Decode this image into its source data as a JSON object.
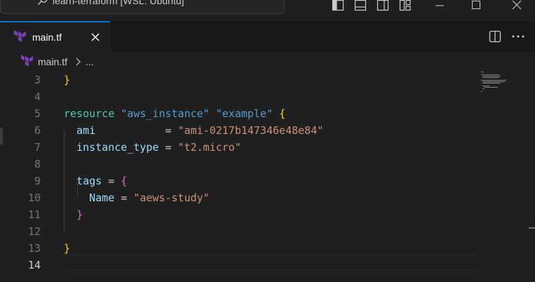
{
  "titlebar": {
    "title": "learn-terraform [WSL: Ubuntu]",
    "icons": [
      "search-icon",
      "toggle-primary-sidebar-icon",
      "toggle-panel-icon",
      "toggle-secondary-sidebar-icon",
      "customize-layout-icon",
      "minimize-icon",
      "maximize-icon",
      "close-window-icon"
    ]
  },
  "tabs": [
    {
      "label": "main.tf",
      "icon": "terraform-icon",
      "active": true
    }
  ],
  "editor_actions": [
    "split-editor-icon",
    "more-actions-icon"
  ],
  "breadcrumb": {
    "file": "main.tf",
    "more": "..."
  },
  "colors": {
    "accent": "#0078d4",
    "terraform": "#7b42bc",
    "keyword": "#4ec9b0",
    "string": "#ce9178",
    "block_label": "#569cd6",
    "attribute": "#9cdcfe",
    "bracket_1": "#ffd700",
    "bracket_2": "#da70d6"
  },
  "code": {
    "current_line": 14,
    "lines": [
      {
        "n": "3",
        "segments": [
          [
            "}",
            "br-y"
          ]
        ]
      },
      {
        "n": "4",
        "segments": []
      },
      {
        "n": "5",
        "segments": [
          [
            "resource",
            "kw"
          ],
          [
            " ",
            "op"
          ],
          [
            "\"aws_instance\"",
            "strb"
          ],
          [
            " ",
            "op"
          ],
          [
            "\"example\"",
            "strb"
          ],
          [
            " ",
            "op"
          ],
          [
            "{",
            "br-y"
          ]
        ]
      },
      {
        "n": "6",
        "segments": [
          [
            "  ami",
            "attr"
          ],
          [
            "           = ",
            "op"
          ],
          [
            "\"ami-0217b147346e48e84\"",
            "str"
          ]
        ]
      },
      {
        "n": "7",
        "segments": [
          [
            "  instance_type",
            "attr"
          ],
          [
            " = ",
            "op"
          ],
          [
            "\"t2.micro\"",
            "str"
          ]
        ]
      },
      {
        "n": "8",
        "segments": []
      },
      {
        "n": "9",
        "segments": [
          [
            "  tags",
            "attr"
          ],
          [
            " = ",
            "op"
          ],
          [
            "{",
            "br-p"
          ]
        ]
      },
      {
        "n": "10",
        "segments": [
          [
            "    Name",
            "attr"
          ],
          [
            " = ",
            "op"
          ],
          [
            "\"aews-study\"",
            "str"
          ]
        ]
      },
      {
        "n": "11",
        "segments": [
          [
            "  ",
            "op"
          ],
          [
            "}",
            "br-p"
          ]
        ]
      },
      {
        "n": "12",
        "segments": []
      },
      {
        "n": "13",
        "segments": [
          [
            "}",
            "br-y"
          ]
        ]
      },
      {
        "n": "14",
        "segments": []
      }
    ]
  }
}
